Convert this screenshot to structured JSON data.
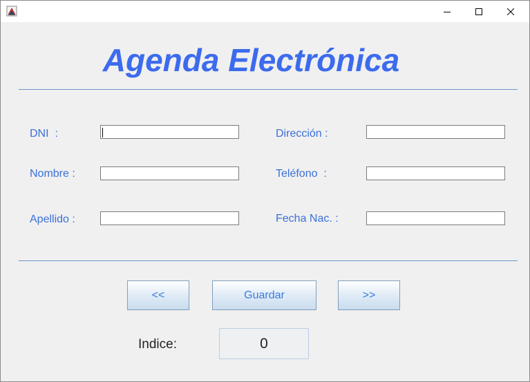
{
  "window": {
    "title": ""
  },
  "header": {
    "title": "Agenda Electrónica"
  },
  "form": {
    "dni": {
      "label": "DNI  :",
      "value": ""
    },
    "nombre": {
      "label": "Nombre :",
      "value": ""
    },
    "apellido": {
      "label": "Apellido :",
      "value": ""
    },
    "direccion": {
      "label": "Dirección :",
      "value": ""
    },
    "telefono": {
      "label": "Teléfono  :",
      "value": ""
    },
    "fecha_nac": {
      "label": "Fecha Nac. :",
      "value": ""
    }
  },
  "buttons": {
    "prev": "<<",
    "save": "Guardar",
    "next": ">>"
  },
  "index": {
    "label": "Indice:",
    "value": "0"
  },
  "colors": {
    "title": "#3c6bed",
    "label": "#3b70d9",
    "separator": "#6e93cc"
  },
  "icons": {
    "app": "java-duke-icon",
    "minimize": "minimize-icon",
    "maximize": "maximize-icon",
    "close": "close-icon"
  }
}
